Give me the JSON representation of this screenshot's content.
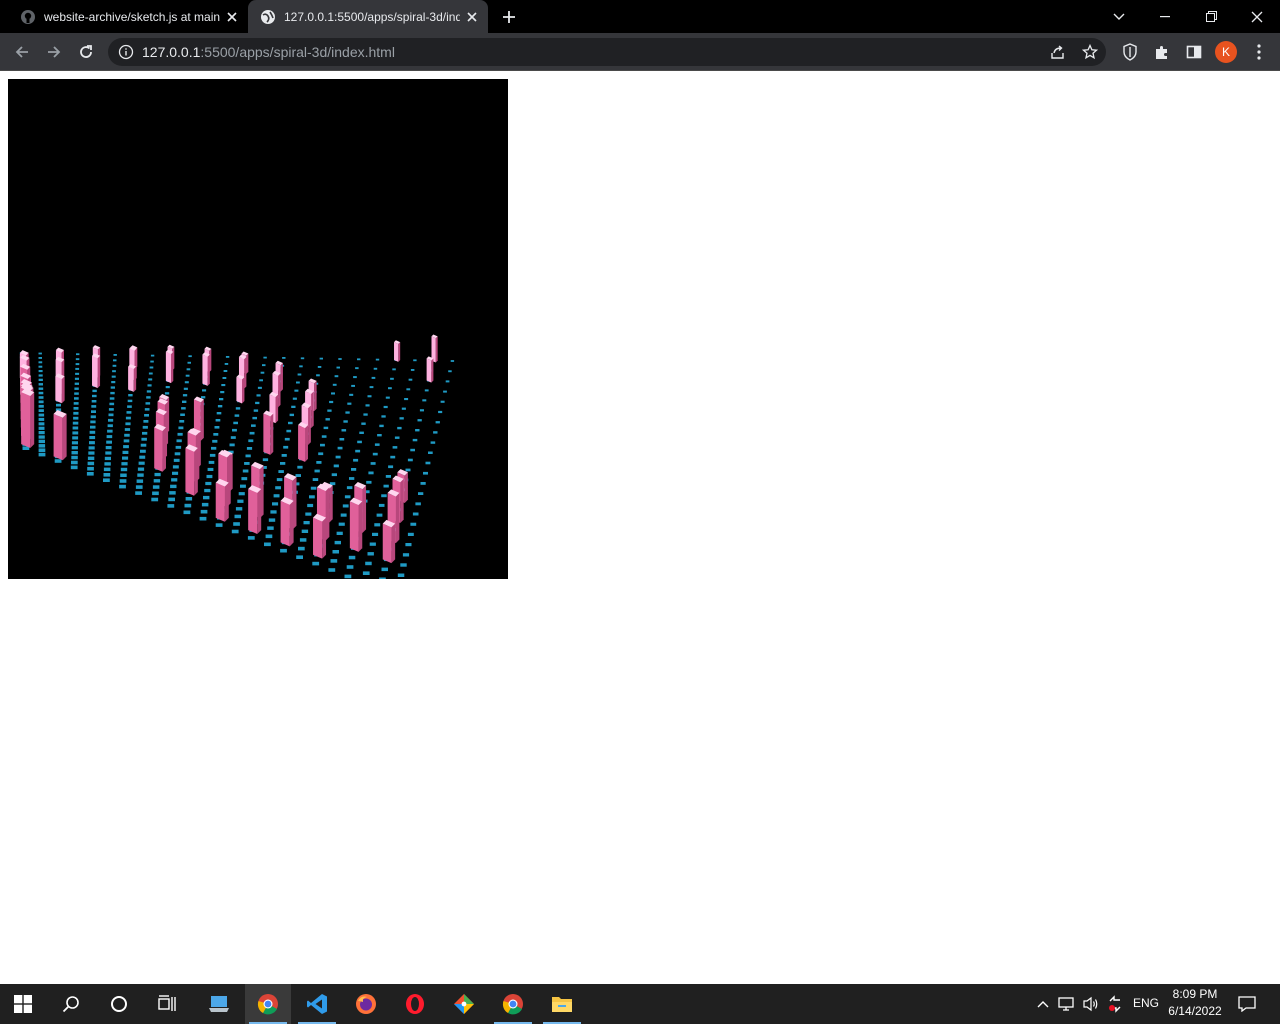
{
  "browser": {
    "tabs": [
      {
        "title": "website-archive/sketch.js at main",
        "icon": "github-icon",
        "active": false
      },
      {
        "title": "127.0.0.1:5500/apps/spiral-3d/index.html",
        "icon": "globe-icon",
        "active": true
      }
    ],
    "url_host": "127.0.0.1",
    "url_rest": ":5500/apps/spiral-3d/index.html",
    "profile_initial": "K",
    "colors": {
      "tabstrip": "#000000",
      "toolbar": "#35363a",
      "omnibox": "#202124",
      "avatar": "#e8531f"
    }
  },
  "scene": {
    "background": "#000000",
    "tile_color": "#1f9ac4",
    "pillar_color_light": "#ffb2e0",
    "pillar_color_dark": "#e0609a"
  },
  "taskbar": {
    "apps": [
      "windows-start-icon",
      "search-icon",
      "cortana-icon",
      "task-view-icon",
      "pc-icon",
      "chrome-icon",
      "vscode-icon",
      "firefox-icon",
      "opera-icon",
      "git-icon",
      "chrome-icon",
      "file-explorer-icon"
    ],
    "language": "ENG",
    "time": "8:09 PM",
    "date": "6/14/2022"
  }
}
